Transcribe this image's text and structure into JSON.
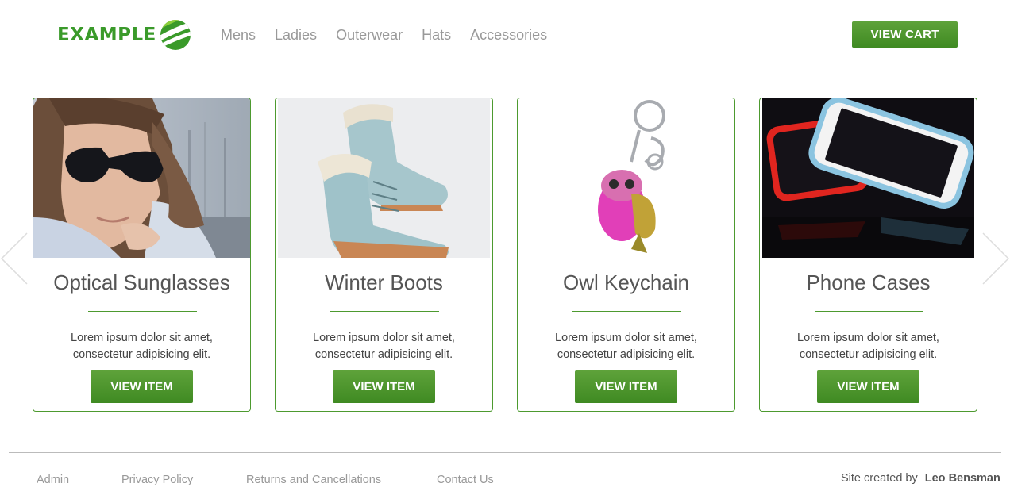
{
  "brand": {
    "logo_text": "EXAMPLE",
    "accent": "#3f8a22"
  },
  "nav": {
    "items": [
      {
        "label": "Mens"
      },
      {
        "label": "Ladies"
      },
      {
        "label": "Outerwear"
      },
      {
        "label": "Hats"
      },
      {
        "label": "Accessories"
      }
    ],
    "cart_label": "VIEW CART"
  },
  "carousel": {
    "prev_icon": "chevron-left-icon",
    "next_icon": "chevron-right-icon",
    "products": [
      {
        "title": "Optical Sunglasses",
        "image": "woman-sunglasses-photo",
        "desc_line1": "Lorem ipsum dolor sit amet,",
        "desc_line2": "consectetur adipisicing elit.",
        "button": "VIEW ITEM"
      },
      {
        "title": "Winter Boots",
        "image": "winter-boots-photo",
        "desc_line1": "Lorem ipsum dolor sit amet,",
        "desc_line2": "consectetur adipisicing elit.",
        "button": "VIEW ITEM"
      },
      {
        "title": "Owl Keychain",
        "image": "owl-keychain-photo",
        "desc_line1": "Lorem ipsum dolor sit amet,",
        "desc_line2": "consectetur adipisicing elit.",
        "button": "VIEW ITEM"
      },
      {
        "title": "Phone Cases",
        "image": "phone-cases-photo",
        "desc_line1": "Lorem ipsum dolor sit amet,",
        "desc_line2": "consectetur adipisicing elit.",
        "button": "VIEW ITEM"
      }
    ]
  },
  "footer": {
    "links": [
      {
        "label": "Admin"
      },
      {
        "label": "Privacy Policy"
      },
      {
        "label": "Returns and Cancellations"
      },
      {
        "label": "Contact Us"
      }
    ],
    "credit_prefix": "Site created by",
    "credit_name": "Leo Bensman"
  }
}
